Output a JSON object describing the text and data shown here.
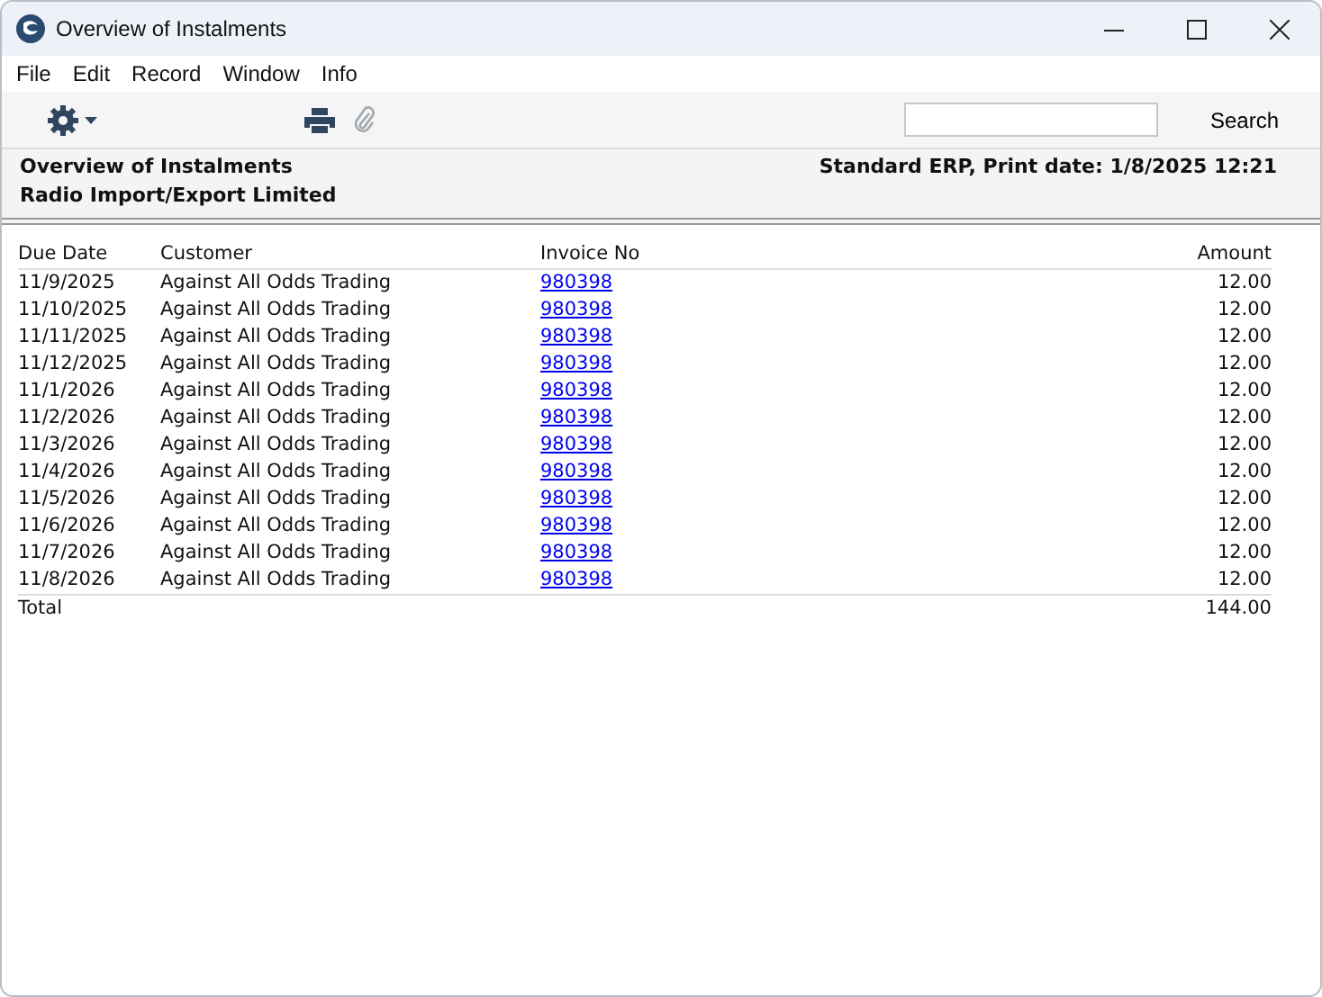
{
  "window": {
    "title": "Overview of Instalments"
  },
  "menu": [
    "File",
    "Edit",
    "Record",
    "Window",
    "Info"
  ],
  "toolbar": {
    "search_button": "Search"
  },
  "report_header": {
    "title": "Overview of Instalments",
    "company": "Radio Import/Export Limited",
    "printed": "Standard ERP, Print date: 1/8/2025 12:21"
  },
  "table": {
    "columns": [
      "Due Date",
      "Customer",
      "Invoice No",
      "Amount"
    ],
    "rows": [
      {
        "due_date": "11/9/2025",
        "customer": "Against All Odds Trading",
        "invoice_no": "980398",
        "amount": "12.00"
      },
      {
        "due_date": "11/10/2025",
        "customer": "Against All Odds Trading",
        "invoice_no": "980398",
        "amount": "12.00"
      },
      {
        "due_date": "11/11/2025",
        "customer": "Against All Odds Trading",
        "invoice_no": "980398",
        "amount": "12.00"
      },
      {
        "due_date": "11/12/2025",
        "customer": "Against All Odds Trading",
        "invoice_no": "980398",
        "amount": "12.00"
      },
      {
        "due_date": "11/1/2026",
        "customer": "Against All Odds Trading",
        "invoice_no": "980398",
        "amount": "12.00"
      },
      {
        "due_date": "11/2/2026",
        "customer": "Against All Odds Trading",
        "invoice_no": "980398",
        "amount": "12.00"
      },
      {
        "due_date": "11/3/2026",
        "customer": "Against All Odds Trading",
        "invoice_no": "980398",
        "amount": "12.00"
      },
      {
        "due_date": "11/4/2026",
        "customer": "Against All Odds Trading",
        "invoice_no": "980398",
        "amount": "12.00"
      },
      {
        "due_date": "11/5/2026",
        "customer": "Against All Odds Trading",
        "invoice_no": "980398",
        "amount": "12.00"
      },
      {
        "due_date": "11/6/2026",
        "customer": "Against All Odds Trading",
        "invoice_no": "980398",
        "amount": "12.00"
      },
      {
        "due_date": "11/7/2026",
        "customer": "Against All Odds Trading",
        "invoice_no": "980398",
        "amount": "12.00"
      },
      {
        "due_date": "11/8/2026",
        "customer": "Against All Odds Trading",
        "invoice_no": "980398",
        "amount": "12.00"
      }
    ],
    "total": {
      "label": "Total",
      "amount": "144.00"
    }
  }
}
